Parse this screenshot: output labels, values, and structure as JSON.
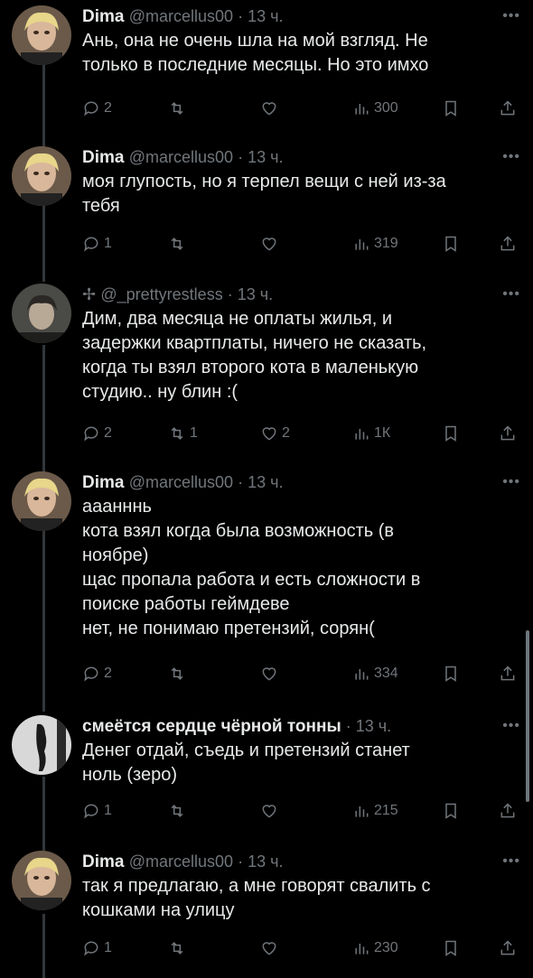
{
  "colors": {
    "background": "#000000",
    "text": "#e7e9ea",
    "muted": "#71767b",
    "thread_line": "#333639"
  },
  "tweets": [
    {
      "name": "Dima",
      "handle": "@marcellus00",
      "time": "13 ч.",
      "text": "Ань, она не очень шла на мой взгляд. Не\nтолько в последние месяцы. Но это имхо",
      "replies": "2",
      "retweets": "",
      "likes": "",
      "views": "300"
    },
    {
      "name": "Dima",
      "handle": "@marcellus00",
      "time": "13 ч.",
      "text": "моя глупость, но я терпел вещи с ней из-за\nтебя",
      "replies": "1",
      "retweets": "",
      "likes": "",
      "views": "319"
    },
    {
      "name": "✢",
      "handle": "@_prettyrestless",
      "time": "13 ч.",
      "text": "Дим, два месяца не оплаты жилья, и\nзадержки квартплаты, ничего не сказать,\nкогда ты взял второго кота в маленькую\nстудию.. ну блин :(",
      "replies": "2",
      "retweets": "1",
      "likes": "2",
      "views": "1К"
    },
    {
      "name": "Dima",
      "handle": "@marcellus00",
      "time": "13 ч.",
      "text": "ааанннь\nкота взял когда была возможность (в\nноябре)\nщас пропала работа и есть сложности в\nпоиске работы геймдеве\nнет, не понимаю претензий, сорян(",
      "replies": "2",
      "retweets": "",
      "likes": "",
      "views": "334"
    },
    {
      "name": "смеётся сердце чёрной тонны",
      "handle": "",
      "time": "13 ч.",
      "text": "Денег отдай,  съедь и претензий станет\nноль (зеро)",
      "replies": "1",
      "retweets": "",
      "likes": "",
      "views": "215"
    },
    {
      "name": "Dima",
      "handle": "@marcellus00",
      "time": "13 ч.",
      "text": "так я предлагаю, а мне говорят свалить с\nкошками на улицу",
      "replies": "1",
      "retweets": "",
      "likes": "",
      "views": "230"
    }
  ]
}
